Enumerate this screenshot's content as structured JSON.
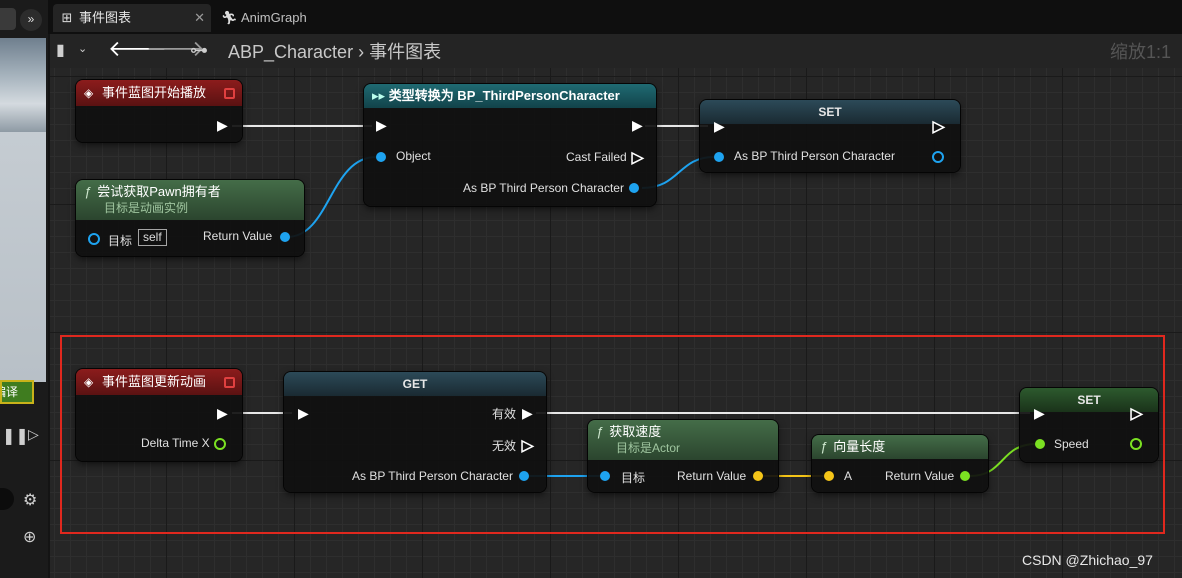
{
  "side_panel": {
    "compile_label": "编译",
    "expand_label": "»"
  },
  "tabs": [
    {
      "label": "事件图表",
      "icon": "event-graph-icon",
      "active": true
    },
    {
      "label": "AnimGraph",
      "icon": "running-figure-icon",
      "active": false
    }
  ],
  "toolbar": {
    "breadcrumb_root": "ABP_Character",
    "breadcrumb_sep": "›",
    "breadcrumb_current": "事件图表",
    "zoom": "缩放1:1"
  },
  "nodes": {
    "begin_play": {
      "title": "事件蓝图开始播放"
    },
    "cast": {
      "title": "类型转换为 BP_ThirdPersonCharacter",
      "pin_object": "Object",
      "pin_cast_failed": "Cast Failed",
      "pin_as": "As BP Third Person Character"
    },
    "set_top": {
      "title": "SET",
      "pin": "As BP Third Person Character"
    },
    "try_get_pawn": {
      "title": "尝试获取Pawn拥有者",
      "subtitle": "目标是动画实例",
      "pin_target": "目标",
      "target_value": "self",
      "pin_return": "Return Value"
    },
    "update_anim": {
      "title": "事件蓝图更新动画",
      "pin_delta": "Delta Time X"
    },
    "get": {
      "title": "GET",
      "pin_valid": "有效",
      "pin_invalid": "无效",
      "pin_input": "As BP Third Person Character"
    },
    "get_velocity": {
      "title": "获取速度",
      "subtitle": "目标是Actor",
      "pin_target": "目标",
      "pin_return": "Return Value"
    },
    "vector_length": {
      "title": "向量长度",
      "pin_a": "A",
      "pin_return": "Return Value"
    },
    "set_speed": {
      "title": "SET",
      "pin": "Speed"
    }
  },
  "colors": {
    "exec": "#ffffff",
    "object_pin": "#1ea3f0",
    "vector_pin": "#f5c518",
    "float_pin": "#7be022",
    "highlight": "#e0281e"
  },
  "watermark": "CSDN @Zhichao_97"
}
